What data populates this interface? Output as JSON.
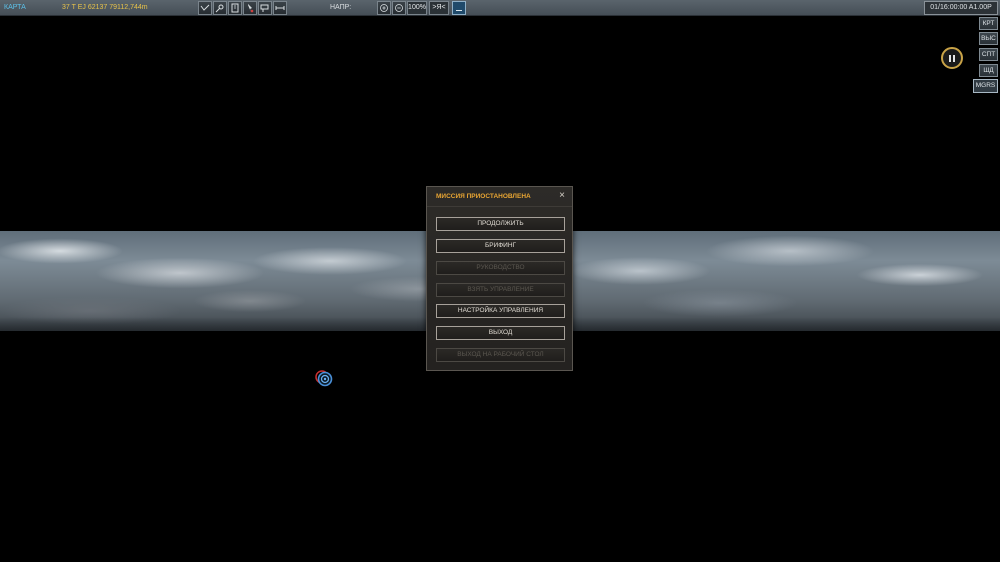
{
  "toolbar": {
    "map_label": "КАРТА",
    "coordinates": "37 T EJ 62137 79112,744m",
    "direction_label": "НАПР:",
    "zoom": "100%",
    "me_label": ">Я<",
    "time": "01/16:00:00 A1.00P",
    "tool_icons": [
      "route-icon",
      "tools-icon",
      "ruler-icon",
      "marker-icon",
      "comment-icon",
      "measure-icon"
    ],
    "zoom_icons": [
      "zoom-in-icon",
      "zoom-out-icon"
    ]
  },
  "side_buttons": [
    "КРТ",
    "ВЫС",
    "СПТ",
    "ШД",
    "MGRS"
  ],
  "dialog": {
    "title": "МИССИЯ ПРИОСТАНОВЛЕНА",
    "close": "×",
    "buttons": [
      {
        "label": "ПРОДОЛЖИТЬ",
        "enabled": true
      },
      {
        "label": "БРИФИНГ",
        "enabled": true
      },
      {
        "label": "РУКОВОДСТВО",
        "enabled": false
      },
      {
        "label": "ВЗЯТЬ УПРАВЛЕНИЕ",
        "enabled": false
      },
      {
        "label": "НАСТРОЙКА УПРАВЛЕНИЯ",
        "enabled": true
      },
      {
        "label": "ВЫХОД",
        "enabled": true
      },
      {
        "label": "ВЫХОД НА РАБОЧИЙ СТОЛ",
        "enabled": false
      }
    ]
  },
  "colors": {
    "map_label": "#5cc0e8",
    "coordinates": "#e8c34a",
    "dialog_title": "#e8a533",
    "pause_ring": "#c9a347"
  }
}
